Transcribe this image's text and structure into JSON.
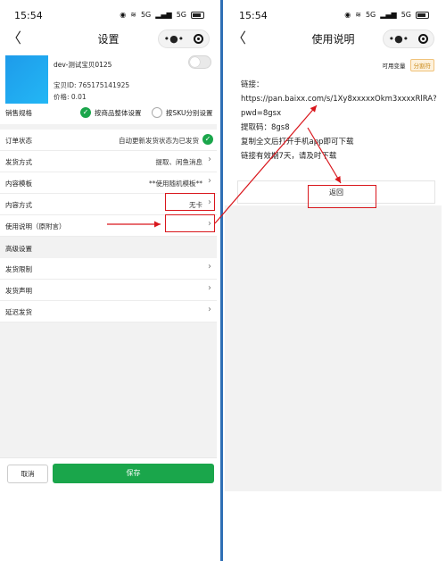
{
  "left": {
    "status": {
      "time": "15:54",
      "icons": [
        "dnd-icon",
        "wifi-icon",
        "signal-icon",
        "battery-icon"
      ],
      "net1": "5G",
      "net2": "5G"
    },
    "nav": {
      "back_icon": "back-icon",
      "title": "设置",
      "more_icon": "more-icon",
      "target_icon": "target-icon"
    },
    "product": {
      "name": "dev-测试宝贝0125",
      "id": "宝贝ID: 765175141925",
      "price": "价格: 0.01"
    },
    "spec": {
      "label": "销售规格",
      "option1": "按商品整体设置",
      "option2": "按SKU分别设置"
    },
    "rows": [
      {
        "label": "订单状态",
        "value": "自动更新发货状态为已发货"
      },
      {
        "label": "发货方式",
        "value": "提取、闲鱼消息"
      },
      {
        "label": "内容模板",
        "value": "**使用随机模板**"
      },
      {
        "label": "内容方式",
        "value": "无卡"
      },
      {
        "label": "使用说明（原附言）",
        "value": ""
      }
    ],
    "advanced": {
      "title": "高级设置",
      "rows": [
        {
          "label": "发货限制"
        },
        {
          "label": "发货声明"
        },
        {
          "label": "延迟发货"
        }
      ]
    },
    "buttons": {
      "cancel": "取消",
      "save": "保存"
    }
  },
  "right": {
    "status": {
      "time": "15:54",
      "net1": "5G",
      "net2": "5G"
    },
    "nav": {
      "title": "使用说明"
    },
    "tags": {
      "variables": "可用变量",
      "separator": "分割符"
    },
    "content": [
      "链接：",
      "https://pan.baixx.com/s/1Xy8xxxxxOkm3xxxxRlRA?pwd=8gsx",
      "提取码：8gs8",
      "复制全文后打开手机app即可下载",
      "链接有效期7天，请及时下载"
    ],
    "return_label": "返回"
  },
  "colors": {
    "primary_green": "#1aa64b",
    "annotation_red": "#d9161c",
    "divider_blue": "#2f6fb5"
  }
}
